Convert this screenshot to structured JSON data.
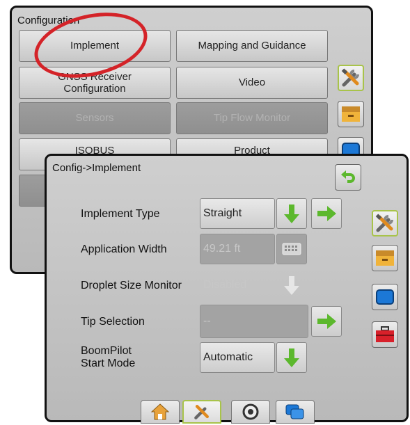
{
  "back_screen": {
    "title": "Configuration",
    "buttons": [
      {
        "label": "Implement",
        "enabled": true
      },
      {
        "label": "Mapping and Guidance",
        "enabled": true
      },
      {
        "label": "GNSS Receiver\nConfiguration",
        "enabled": true
      },
      {
        "label": "Video",
        "enabled": true
      },
      {
        "label": "Sensors",
        "enabled": false
      },
      {
        "label": "Tip Flow Monitor",
        "enabled": false
      },
      {
        "label": "ISOBUS",
        "enabled": true
      },
      {
        "label": "Product",
        "enabled": true
      }
    ],
    "side_icons": [
      "tools-icon",
      "file-box-icon",
      "monitor-icon"
    ]
  },
  "front_screen": {
    "breadcrumb": "Config->Implement",
    "rows": [
      {
        "label": "Implement Type",
        "value": "Straight",
        "enabled": true
      },
      {
        "label": "Application Width",
        "value": "49.21 ft",
        "enabled": false
      },
      {
        "label": "Droplet Size Monitor",
        "value": "Disabled",
        "enabled": false
      },
      {
        "label": "Tip Selection",
        "value": "--",
        "enabled": false
      },
      {
        "label": "BoomPilot\nStart Mode",
        "value": "Automatic",
        "enabled": true
      }
    ],
    "side_icons": [
      "tools-icon",
      "file-box-icon",
      "monitor-icon",
      "toolbox-icon"
    ],
    "bottom_tabs": [
      "home-icon",
      "tools-icon",
      "gauge-icon",
      "screens-icon"
    ]
  },
  "colors": {
    "accent_green": "#5cb82d",
    "highlight_red": "#d42328",
    "active_border": "#a8c34a"
  }
}
